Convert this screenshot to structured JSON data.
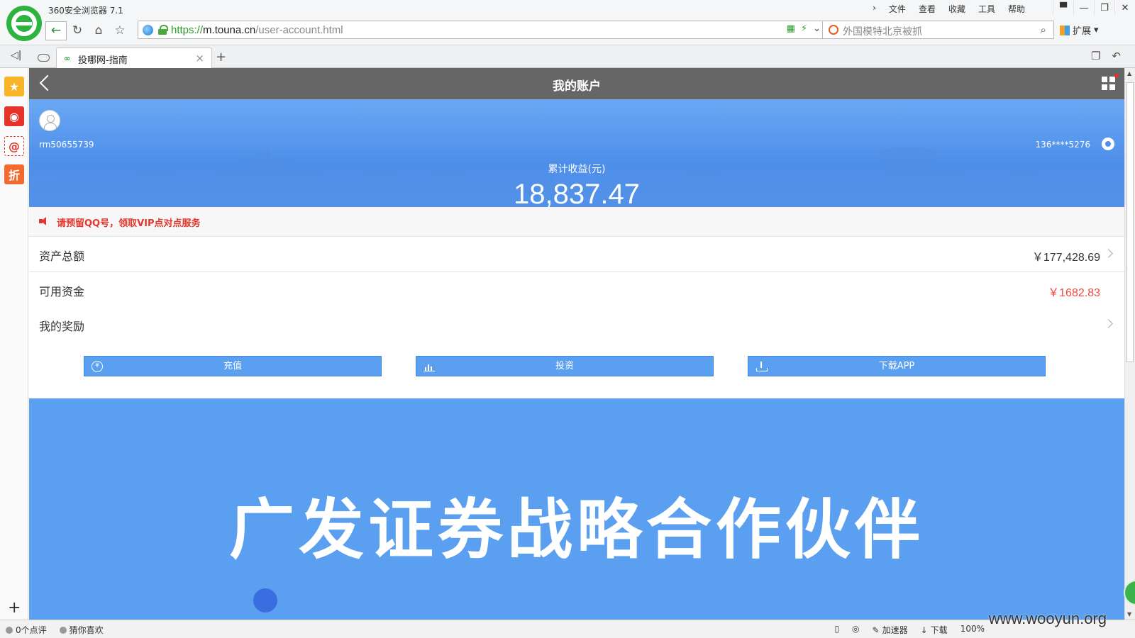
{
  "browser": {
    "title": "360安全浏览器 7.1",
    "menu": [
      "文件",
      "查看",
      "收藏",
      "工具",
      "帮助"
    ],
    "url_scheme": "https://",
    "url_domain": "m.touna.cn",
    "url_path": "/user-account.html",
    "search_placeholder": "外国模特北京被抓",
    "extensions_label": "扩展",
    "tab_label": "投哪网-指南"
  },
  "header": {
    "title": "我的账户"
  },
  "profile": {
    "username": "rm50655739",
    "phone": "136****5276",
    "earnings_label": "累计收益(元)",
    "earnings_value": "18,837.47"
  },
  "notice": {
    "text": "请预留QQ号，领取VIP点对点服务"
  },
  "rows": [
    {
      "label": "资产总额",
      "value": "￥177,428.69"
    },
    {
      "label": "可用资金",
      "value": "￥1682.83"
    },
    {
      "label": "我的奖励",
      "value": ""
    }
  ],
  "actions": [
    {
      "label": "充值",
      "icon": "yuan-circle-icon"
    },
    {
      "label": "投资",
      "icon": "bar-chart-icon"
    },
    {
      "label": "下载APP",
      "icon": "download-icon"
    }
  ],
  "banner": {
    "text": "广发证券战略合作伙伴"
  },
  "statusbar": {
    "left": [
      "0个点评",
      "猜你喜欢"
    ],
    "right": [
      "加速器",
      "下载",
      "100%"
    ]
  },
  "watermark": "www.wooyun.org",
  "colors": {
    "accent": "#5a9ff0",
    "header": "#666666",
    "alert": "#e5352c",
    "brand_green": "#2db33f"
  }
}
